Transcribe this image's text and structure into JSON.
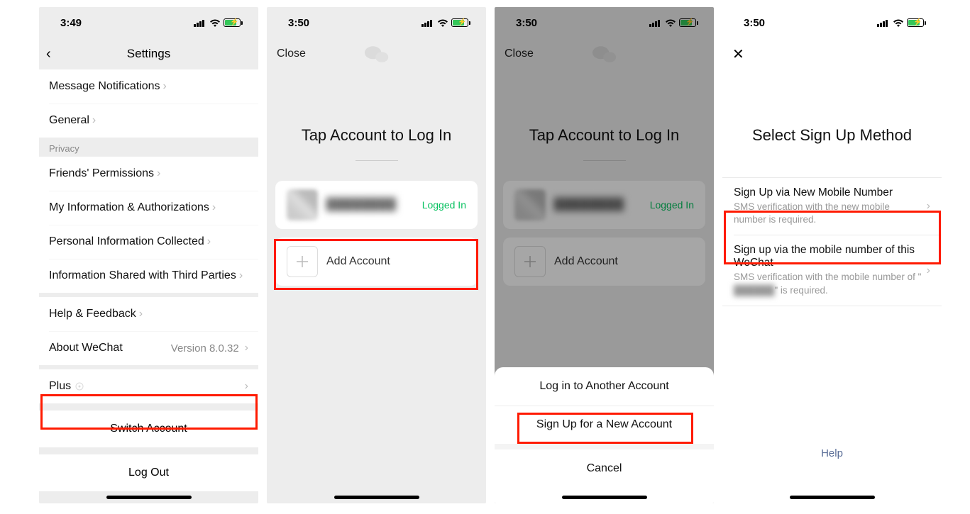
{
  "status": {
    "t1": "3:49",
    "t2": "3:50",
    "t3": "3:50",
    "t4": "3:50"
  },
  "s1": {
    "navTitle": "Settings",
    "items": {
      "msgNotif": "Message Notifications",
      "general": "General",
      "privacyHdr": "Privacy",
      "friendsPerm": "Friends' Permissions",
      "myInfo": "My Information & Authorizations",
      "personalInfo": "Personal Information Collected",
      "thirdParties": "Information Shared with Third Parties",
      "helpFb": "Help & Feedback",
      "about": "About WeChat",
      "aboutVer": "Version 8.0.32",
      "plus": "Plus",
      "switchAcct": "Switch Account",
      "logOut": "Log Out"
    }
  },
  "s2": {
    "close": "Close",
    "title": "Tap Account to Log In",
    "acctNameMasked": "████████",
    "logged": "Logged In",
    "addAcct": "Add Account"
  },
  "s3": {
    "close": "Close",
    "title": "Tap Account to Log In",
    "acctNameMasked": "████████",
    "logged": "Logged In",
    "addAcct": "Add Account",
    "sheetLogin": "Log in to Another Account",
    "sheetSignup": "Sign Up for a New Account",
    "sheetCancel": "Cancel"
  },
  "s4": {
    "title": "Select Sign Up Method",
    "opt1h": "Sign Up via New Mobile Number",
    "opt1s": "SMS verification with the new mobile number is required.",
    "opt2h": "Sign up via the mobile number of this WeChat",
    "opt2s_a": "SMS verification with the mobile number of \"",
    "opt2s_mask": "██████",
    "opt2s_b": "\" is required.",
    "help": "Help"
  }
}
